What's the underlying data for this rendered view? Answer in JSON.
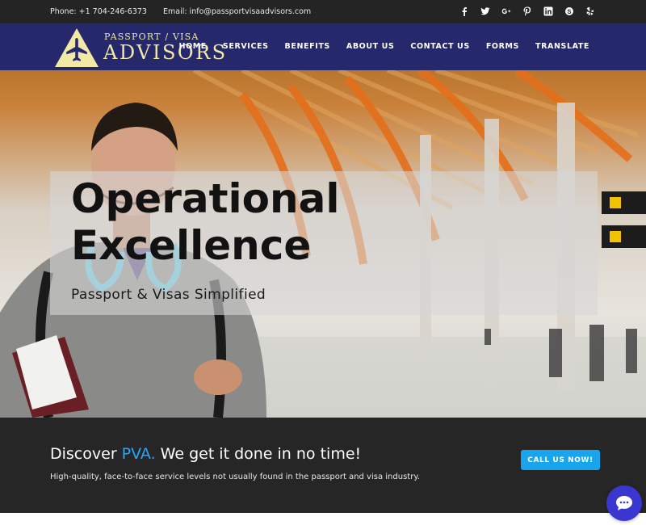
{
  "topbar": {
    "phone": "Phone: +1 704-246-6373",
    "email": "Email: info@passportvisaadvisors.com",
    "social_icons": [
      "facebook-icon",
      "twitter-icon",
      "google-plus-icon",
      "pinterest-icon",
      "linkedin-icon",
      "skype-icon",
      "yelp-icon"
    ]
  },
  "logo": {
    "line1": "PASSPORT / VISA",
    "line2": "ADVISORS"
  },
  "nav": {
    "items": [
      "HOME",
      "SERVICES",
      "BENEFITS",
      "ABOUT US",
      "CONTACT US",
      "FORMS",
      "TRANSLATE"
    ]
  },
  "hero": {
    "title_line1": "Operational",
    "title_line2": "Excellence",
    "subtitle": "Passport & Visas Simplified"
  },
  "discover": {
    "heading_prefix": "Discover ",
    "heading_accent": "PVA.",
    "heading_suffix": " We get it done in no time!",
    "text": "High-quality, face-to-face service levels not usually found in the passport and visa industry.",
    "cta_label": "CALL US NOW!"
  },
  "colors": {
    "topbar_bg": "#242424",
    "nav_bg": "#25296b",
    "logo_yellow": "#f2e9a6",
    "accent_blue": "#27a7ff",
    "cta_blue": "#19a4ee",
    "strip_bg": "#262626",
    "chat_bg": "#3a37d1"
  },
  "chat": {
    "icon": "chat-bubble-icon"
  }
}
